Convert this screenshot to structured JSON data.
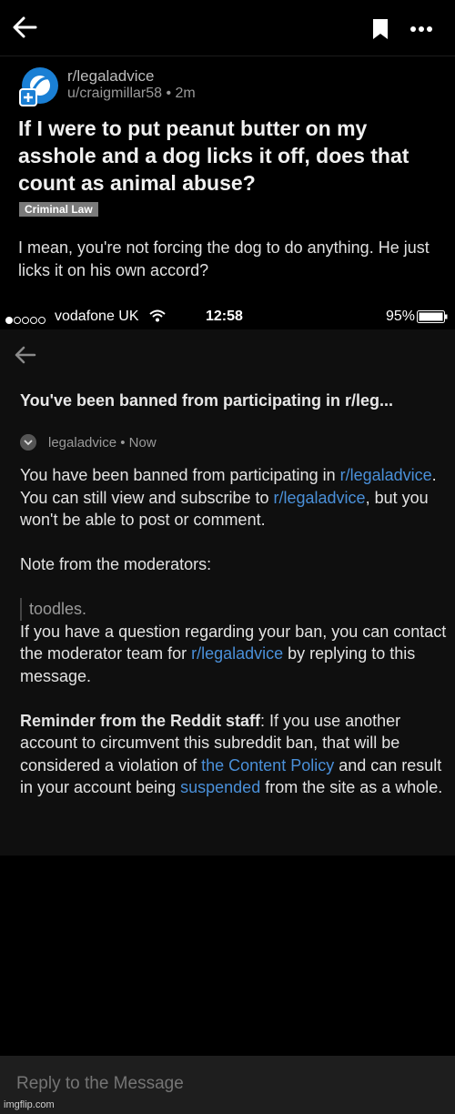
{
  "post": {
    "subreddit": "r/legaladvice",
    "meta": "u/craigmillar58 • 2m",
    "title": "If I were to put peanut butter on my asshole and a dog licks it off, does that count as animal abuse?",
    "flair": "Criminal Law",
    "body": "I mean, you're not forcing the dog to do anything. He just licks it on his own accord?",
    "icons": [
      "back-arrow-icon",
      "bookmark-icon",
      "more-icon"
    ]
  },
  "statusbar": {
    "carrier": "vodafone UK",
    "time": "12:58",
    "battery": "95%",
    "signal_bars_filled": 1,
    "signal_bars_total": 5
  },
  "message": {
    "subject": "You've been banned from participating in r/leg...",
    "sender": "legaladvice • Now",
    "p1_a": "You have been banned from participating in ",
    "p1_link1": "r/legaladvice",
    "p1_b": ". You can still view and subscribe to ",
    "p1_link2": "r/legaladvice",
    "p1_c": ", but you won't be able to post or comment.",
    "note_heading": "Note from the moderators:",
    "quote": "toodles.",
    "p3_a": "If you have a question regarding your ban, you can contact the moderator team for ",
    "p3_link": "r/legaladvice",
    "p3_b": " by replying to this message.",
    "p4_bold": "Reminder from the Reddit staff",
    "p4_a": ": If you use another account to circumvent this subreddit ban, that will be considered a violation of ",
    "p4_link1": "the Content Policy",
    "p4_b": " and can result in your account being ",
    "p4_link2": "suspended",
    "p4_c": " from the site as a whole."
  },
  "reply": {
    "placeholder": "Reply to the Message"
  },
  "watermark": "imgflip.com",
  "colors": {
    "link": "#4a90d9",
    "background": "#000000",
    "panel": "#0f0f0f"
  }
}
